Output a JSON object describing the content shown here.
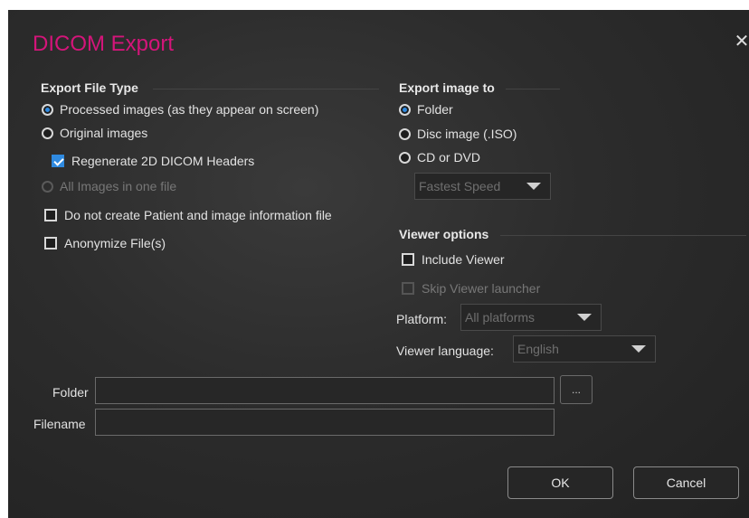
{
  "dialog": {
    "title": "DICOM Export",
    "close_glyph": "✕"
  },
  "export_file_type": {
    "heading": "Export File Type",
    "options": [
      {
        "label": "Processed images (as they appear on screen)",
        "selected": true
      },
      {
        "label": "Original images",
        "selected": false
      }
    ],
    "regenerate_headers": {
      "label": "Regenerate 2D DICOM Headers",
      "checked": true
    },
    "all_in_one_file": {
      "label": "All Images in one file",
      "enabled": false
    },
    "no_patient_info": {
      "label": "Do not create Patient and image information file",
      "checked": false
    },
    "anonymize": {
      "label": "Anonymize File(s)",
      "checked": false
    }
  },
  "export_image_to": {
    "heading": "Export image to",
    "options": [
      {
        "label": "Folder",
        "selected": true
      },
      {
        "label": "Disc image (.ISO)",
        "selected": false
      },
      {
        "label": "CD or DVD",
        "selected": false
      }
    ],
    "speed": {
      "value": "Fastest Speed",
      "enabled": false
    }
  },
  "viewer_options": {
    "heading": "Viewer options",
    "include_viewer": {
      "label": "Include Viewer",
      "checked": false
    },
    "skip_launcher": {
      "label": "Skip Viewer launcher",
      "enabled": false
    },
    "platform": {
      "label": "Platform:",
      "value": "All platforms"
    },
    "language": {
      "label": "Viewer language:",
      "value": "English"
    }
  },
  "paths": {
    "folder_label": "Folder",
    "folder_value": "",
    "filename_label": "Filename",
    "filename_value": "",
    "browse_label": "..."
  },
  "buttons": {
    "ok": "OK",
    "cancel": "Cancel"
  },
  "colors": {
    "title": "#d4157a",
    "accent": "#2f8ae0",
    "background": "#2c2c2c"
  }
}
